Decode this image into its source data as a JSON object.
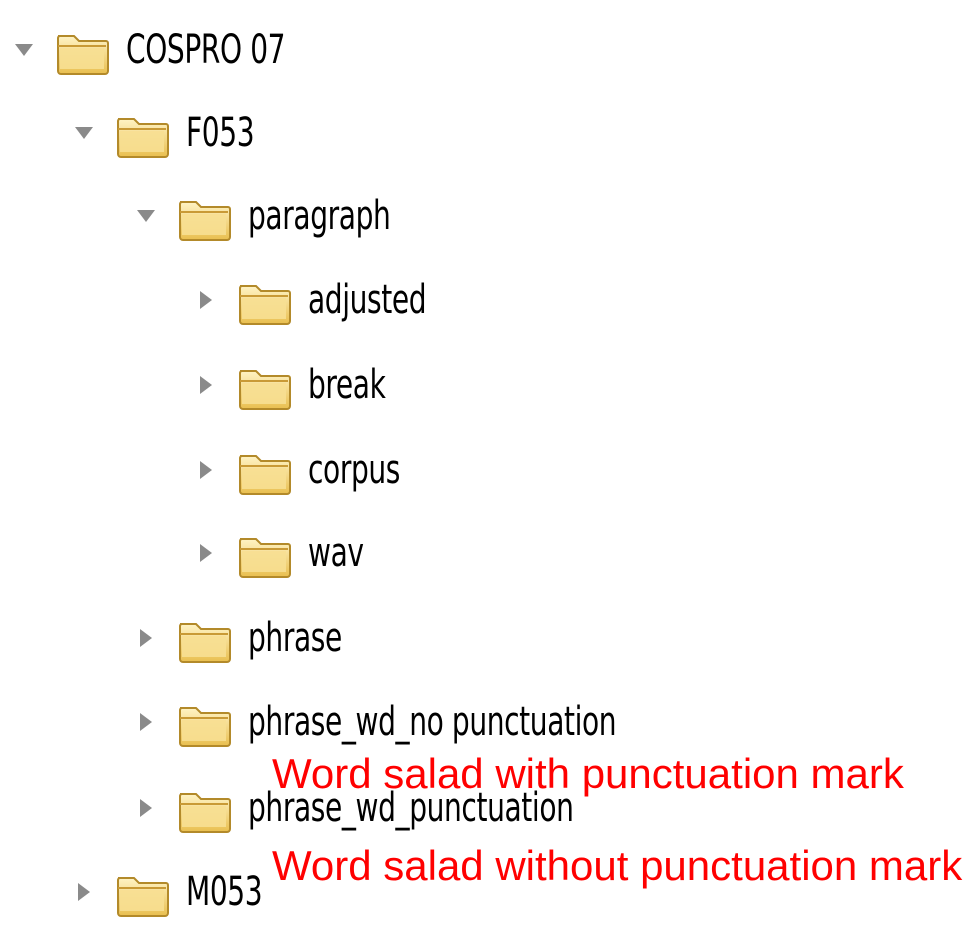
{
  "tree": {
    "items": [
      {
        "label": "COSPRO 07",
        "expanded": true
      },
      {
        "label": "F053",
        "expanded": true
      },
      {
        "label": "paragraph",
        "expanded": true
      },
      {
        "label": "adjusted",
        "expanded": false
      },
      {
        "label": "break",
        "expanded": false
      },
      {
        "label": "corpus",
        "expanded": false
      },
      {
        "label": "wav",
        "expanded": false
      },
      {
        "label": "phrase",
        "expanded": false
      },
      {
        "label": "phrase_wd_no punctuation",
        "expanded": false
      },
      {
        "label": "phrase_wd_punctuation",
        "expanded": false
      },
      {
        "label": "M053",
        "expanded": false
      }
    ]
  },
  "annotations": {
    "with_punctuation": "Word salad with punctuation mark",
    "without_punctuation": "Word salad without punctuation mark",
    "color": "#ff0000"
  },
  "colors": {
    "folder_fill": "#f4d57a",
    "folder_stroke": "#b38a2a",
    "triangle": "#8a8a8a"
  }
}
